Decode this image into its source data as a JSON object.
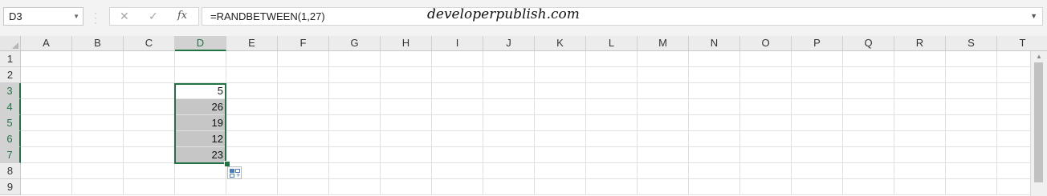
{
  "name_box": {
    "value": "D3"
  },
  "formula_bar": {
    "cancel_glyph": "✕",
    "enter_glyph": "✓",
    "fx_label": "fx",
    "formula": "=RANDBETWEEN(1,27)"
  },
  "watermark": "developerpublish.com",
  "columns": [
    "A",
    "B",
    "C",
    "D",
    "E",
    "F",
    "G",
    "H",
    "I",
    "J",
    "K",
    "L",
    "M",
    "N",
    "O",
    "P",
    "Q",
    "R",
    "S",
    "T"
  ],
  "selected_column": "D",
  "rows": [
    "1",
    "2",
    "3",
    "4",
    "5",
    "6",
    "7",
    "8",
    "9"
  ],
  "selected_rows": [
    "3",
    "4",
    "5",
    "6",
    "7"
  ],
  "cells": {
    "D3": "5",
    "D4": "26",
    "D5": "19",
    "D6": "12",
    "D7": "23"
  },
  "colors": {
    "accent": "#217346",
    "selection_fill": "#c6c6c6"
  },
  "icons": {
    "name_box_dropdown": "chevron-down-icon",
    "quick_analysis": "quick-analysis-icon"
  }
}
